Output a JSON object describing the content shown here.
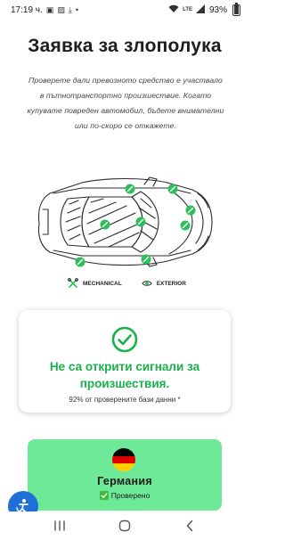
{
  "status_bar": {
    "time": "17:19 ч.",
    "battery": "93%",
    "network": "LTE"
  },
  "page": {
    "title": "Заявка за злополука",
    "intro": "Проверете дали превозното средство е участвало в пътнотранспортно произшествие. Когато купувате повреден автомобил, бъдете внимателни или по-скоро се откажете."
  },
  "legend": {
    "mechanical": "MECHANICAL",
    "exterior": "EXTERIOR"
  },
  "result": {
    "headline": "Не са открити сигнали за произшествия.",
    "note": "92% от проверените бази данни *"
  },
  "country": {
    "name": "Германия",
    "status": "Проверено",
    "flag_colors": [
      "#000000",
      "#dd0000",
      "#ffce00"
    ]
  },
  "colors": {
    "accent_green": "#17b24a",
    "card_green": "#6ee997",
    "marker_green": "#2fbf5a",
    "help_blue": "#1e6fd6"
  },
  "icons": {
    "help": "accessibility-help-icon",
    "nav_recent": "recent-apps-icon",
    "nav_home": "home-icon",
    "nav_back": "back-icon"
  }
}
